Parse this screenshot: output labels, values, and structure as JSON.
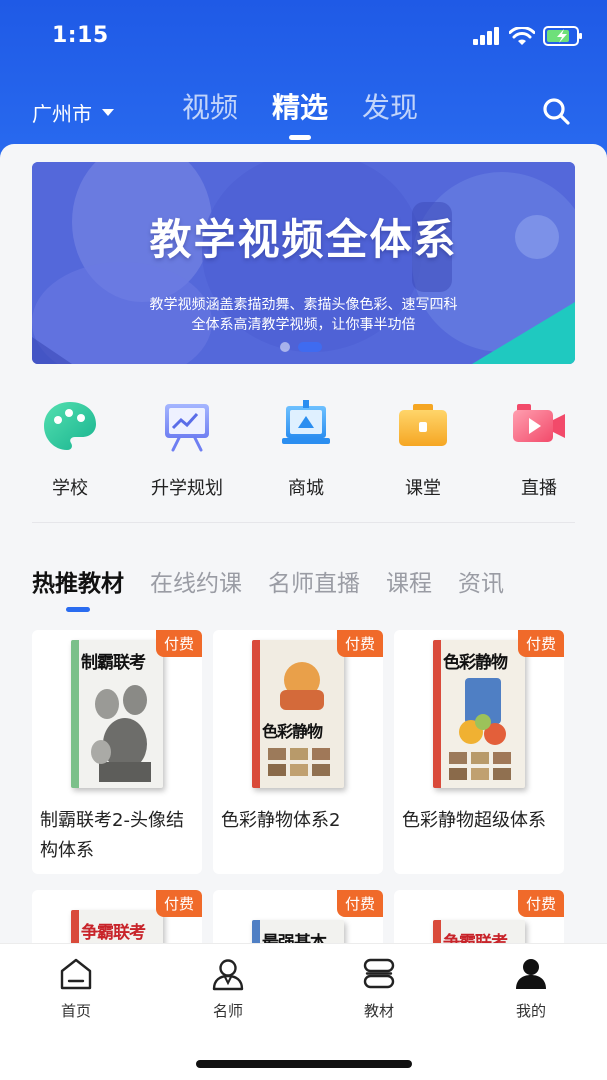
{
  "status_bar": {
    "time": "1:15"
  },
  "header": {
    "city": "广州市",
    "tabs": [
      {
        "label": "视频",
        "active": false
      },
      {
        "label": "精选",
        "active": true
      },
      {
        "label": "发现",
        "active": false
      }
    ]
  },
  "banner": {
    "title": "教学视频全体系",
    "subtitle_line1": "教学视频涵盖素描劲舞、素描头像色彩、速写四科",
    "subtitle_line2": "全体系高清教学视频，让你事半功倍"
  },
  "quick_entries": [
    {
      "label": "学校",
      "icon": "palette-icon"
    },
    {
      "label": "升学规划",
      "icon": "presentation-board-icon"
    },
    {
      "label": "商城",
      "icon": "store-display-icon"
    },
    {
      "label": "课堂",
      "icon": "briefcase-icon"
    },
    {
      "label": "直播",
      "icon": "video-camera-icon"
    }
  ],
  "section_tabs": [
    {
      "label": "热推教材",
      "active": true
    },
    {
      "label": "在线约课",
      "active": false
    },
    {
      "label": "名师直播",
      "active": false
    },
    {
      "label": "课程",
      "active": false
    },
    {
      "label": "资讯",
      "active": false
    }
  ],
  "books": [
    {
      "title": "制霸联考2-头像结构体系",
      "badge": "付费",
      "cover_text": "制霸联考"
    },
    {
      "title": "色彩静物体系2",
      "badge": "付费",
      "cover_text": "色彩静物"
    },
    {
      "title": "色彩静物超级体系",
      "badge": "付费",
      "cover_text": "色彩静物"
    },
    {
      "title": "",
      "badge": "付费",
      "cover_text": "争霸联考"
    },
    {
      "title": "",
      "badge": "付费",
      "cover_text": "最强基本功"
    },
    {
      "title": "",
      "badge": "付费",
      "cover_text": "争霸联考"
    }
  ],
  "bottom_nav": [
    {
      "label": "首页",
      "icon": "home-icon"
    },
    {
      "label": "名师",
      "icon": "teacher-icon"
    },
    {
      "label": "教材",
      "icon": "books-icon"
    },
    {
      "label": "我的",
      "icon": "profile-icon"
    }
  ],
  "colors": {
    "primary": "#2a6cf0",
    "badge": "#f06a2a"
  }
}
